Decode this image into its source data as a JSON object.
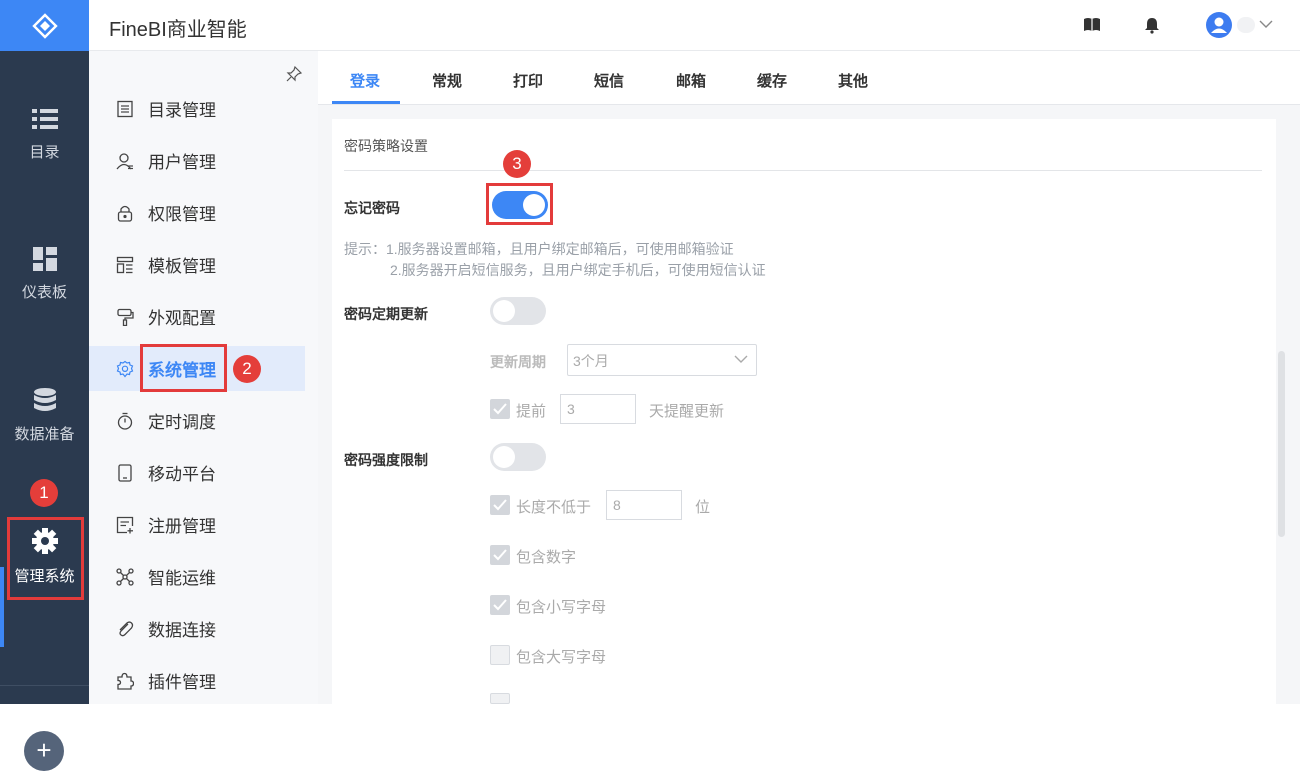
{
  "app": {
    "title": "FineBI商业智能"
  },
  "rail": {
    "items": [
      {
        "label": "目录",
        "icon": "list-icon"
      },
      {
        "label": "仪表板",
        "icon": "dashboard-icon"
      },
      {
        "label": "数据准备",
        "icon": "database-icon"
      },
      {
        "label": "管理系统",
        "icon": "gear-icon",
        "active": true
      }
    ]
  },
  "nav": {
    "items": [
      {
        "label": "目录管理",
        "icon": "catalog-icon"
      },
      {
        "label": "用户管理",
        "icon": "user-icon"
      },
      {
        "label": "权限管理",
        "icon": "lock-icon"
      },
      {
        "label": "模板管理",
        "icon": "template-icon"
      },
      {
        "label": "外观配置",
        "icon": "brush-icon"
      },
      {
        "label": "系统管理",
        "icon": "gear-icon",
        "active": true
      },
      {
        "label": "定时调度",
        "icon": "timer-icon"
      },
      {
        "label": "移动平台",
        "icon": "tablet-icon"
      },
      {
        "label": "注册管理",
        "icon": "register-icon"
      },
      {
        "label": "智能运维",
        "icon": "network-icon"
      },
      {
        "label": "数据连接",
        "icon": "link-icon"
      },
      {
        "label": "插件管理",
        "icon": "puzzle-icon"
      }
    ]
  },
  "tabs": [
    "登录",
    "常规",
    "打印",
    "短信",
    "邮箱",
    "缓存",
    "其他"
  ],
  "active_tab": "登录",
  "annotations": {
    "step1": "1",
    "step2": "2",
    "step3": "3"
  },
  "settings": {
    "section_title": "密码策略设置",
    "forgot_password": {
      "label": "忘记密码",
      "enabled": true
    },
    "hint_line1": "提示：1.服务器设置邮箱，且用户绑定邮箱后，可使用邮箱验证",
    "hint_line2": "2.服务器开启短信服务，且用户绑定手机后，可使用短信认证",
    "periodic_update": {
      "label": "密码定期更新",
      "enabled": false
    },
    "update_cycle": {
      "label": "更新周期",
      "value": "3个月"
    },
    "remind": {
      "prefix": "提前",
      "value": "3",
      "suffix": "天提醒更新",
      "checked": true
    },
    "strength": {
      "label": "密码强度限制",
      "enabled": false
    },
    "min_length": {
      "prefix": "长度不低于",
      "value": "8",
      "suffix": "位",
      "checked": true
    },
    "rules": [
      {
        "label": "包含数字",
        "checked": true
      },
      {
        "label": "包含小写字母",
        "checked": true
      },
      {
        "label": "包含大写字母",
        "checked": false
      }
    ]
  },
  "colors": {
    "accent": "#3d87f5",
    "rail_bg": "#2b3a4f",
    "annotation_red": "#e33b3b"
  }
}
